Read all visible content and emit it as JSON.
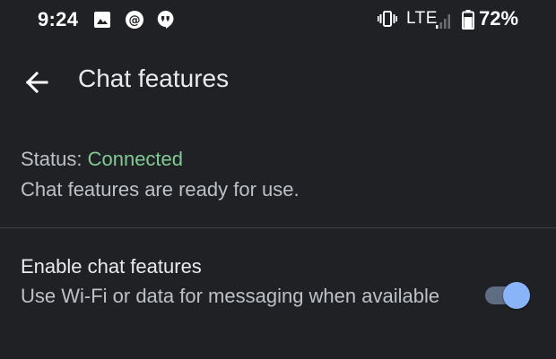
{
  "status_bar": {
    "time": "9:24",
    "notification_icons": [
      "gallery-icon",
      "email-at-icon",
      "hangouts-icon"
    ],
    "network": "LTE",
    "battery_percent": "72%",
    "system_icons": [
      "vibrate-icon",
      "signal-icon",
      "battery-icon"
    ]
  },
  "app_bar": {
    "title": "Chat features",
    "back_icon": "arrow-back-icon"
  },
  "status": {
    "label": "Status: ",
    "value": "Connected",
    "description": "Chat features are ready for use."
  },
  "enable_setting": {
    "title": "Enable chat features",
    "description": "Use Wi-Fi or data for messaging when available",
    "enabled": true
  },
  "colors": {
    "background": "#202124",
    "status_connected": "#81c995",
    "toggle_thumb": "#8ab4f8",
    "toggle_track": "#5f6d84"
  }
}
